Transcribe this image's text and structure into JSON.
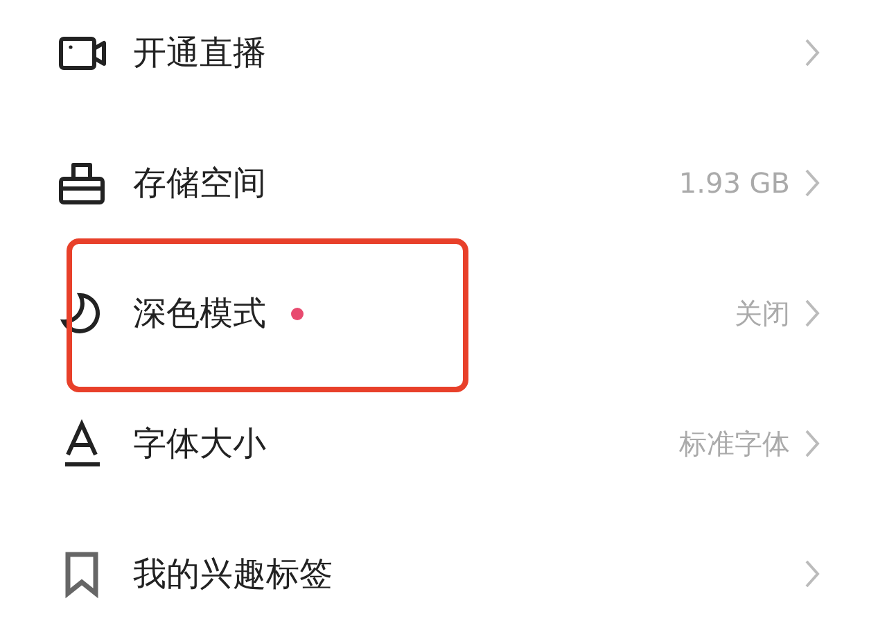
{
  "settings": [
    {
      "kind": "camera",
      "label": "开通直播",
      "highlighted": false
    },
    {
      "kind": "storage",
      "label": "存储空间",
      "value": "1.93 GB",
      "highlighted": false
    },
    {
      "kind": "moon",
      "label": "深色模式",
      "value": "关闭",
      "highlighted": true,
      "color": "#e84a6f"
    },
    {
      "kind": "font",
      "label": "字体大小",
      "value": "标准字体",
      "highlighted": false
    },
    {
      "kind": "bookmark",
      "label": "我的兴趣标签",
      "highlighted": false
    }
  ]
}
